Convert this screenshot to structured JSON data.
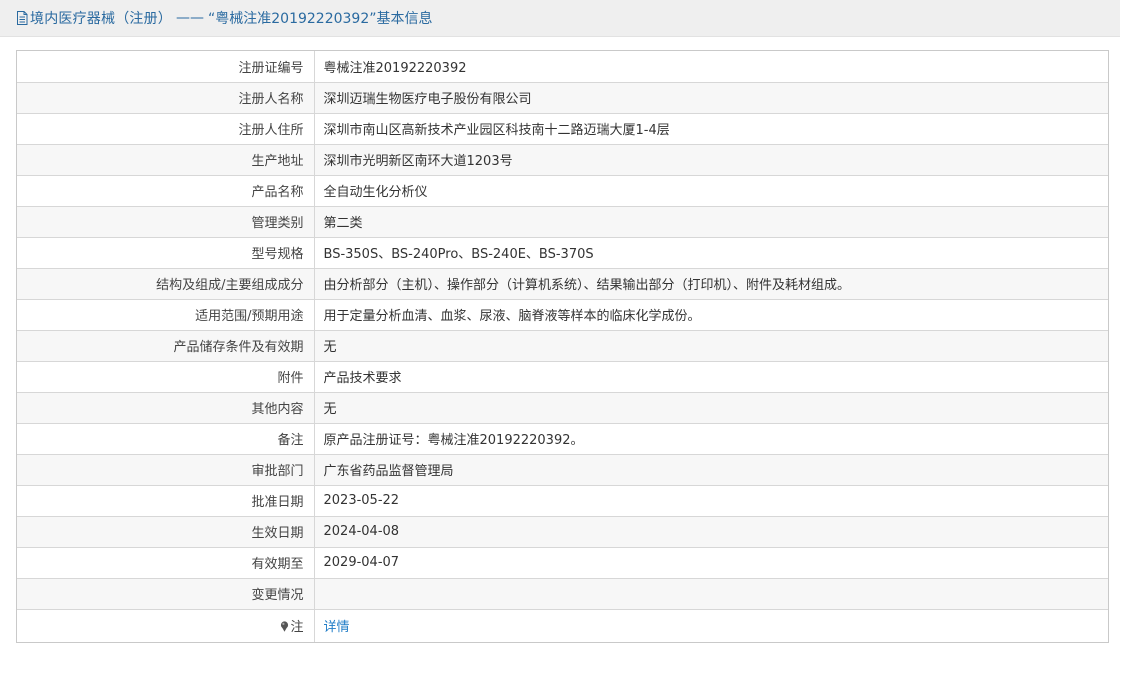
{
  "header": {
    "title": "境内医疗器械（注册）",
    "separator": "——",
    "quoted_title": "“粤械注准20192220392”基本信息"
  },
  "rows": [
    {
      "label": "注册证编号",
      "value": "粤械注准20192220392"
    },
    {
      "label": "注册人名称",
      "value": "深圳迈瑞生物医疗电子股份有限公司"
    },
    {
      "label": "注册人住所",
      "value": "深圳市南山区高新技术产业园区科技南十二路迈瑞大厦1-4层"
    },
    {
      "label": "生产地址",
      "value": "深圳市光明新区南环大道1203号"
    },
    {
      "label": "产品名称",
      "value": "全自动生化分析仪"
    },
    {
      "label": "管理类别",
      "value": "第二类"
    },
    {
      "label": "型号规格",
      "value": "BS-350S、BS-240Pro、BS-240E、BS-370S"
    },
    {
      "label": "结构及组成/主要组成成分",
      "value": "由分析部分（主机）、操作部分（计算机系统）、结果输出部分（打印机）、附件及耗材组成。"
    },
    {
      "label": "适用范围/预期用途",
      "value": "用于定量分析血清、血浆、尿液、脑脊液等样本的临床化学成份。"
    },
    {
      "label": "产品储存条件及有效期",
      "value": "无"
    },
    {
      "label": "附件",
      "value": "产品技术要求"
    },
    {
      "label": "其他内容",
      "value": "无"
    },
    {
      "label": "备注",
      "value": "原产品注册证号：粤械注准20192220392。"
    },
    {
      "label": "审批部门",
      "value": "广东省药品监督管理局"
    },
    {
      "label": "批准日期",
      "value": "2023-05-22"
    },
    {
      "label": "生效日期",
      "value": "2024-04-08"
    },
    {
      "label": "有效期至",
      "value": "2029-04-07"
    },
    {
      "label": "变更情况",
      "value": ""
    }
  ],
  "note_row": {
    "label": "注",
    "link_text": "详情",
    "link_color": "#1f7cc7"
  },
  "colors": {
    "title": "#2a6aa0",
    "header_bg": "#efefef",
    "row_alt_bg": "#f7f7f7",
    "border": "#d7d7d7"
  }
}
